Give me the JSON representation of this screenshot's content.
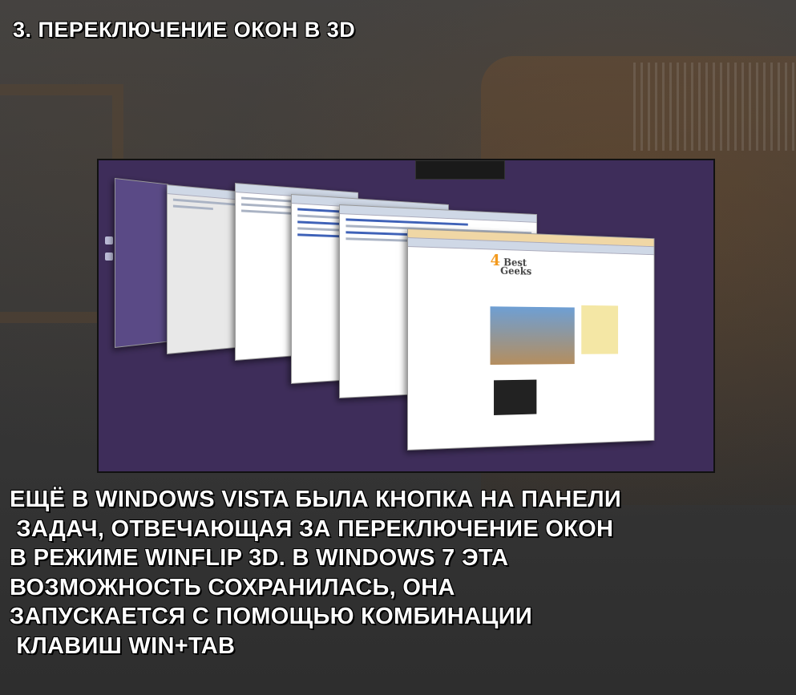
{
  "heading": "3. ПЕРЕКЛЮЧЕНИЕ ОКОН В 3D",
  "screenshot_logo": {
    "digit": "4",
    "word1": "Best",
    "word2": "Geeks"
  },
  "body_lines": [
    "ЕЩЁ В WINDOWS VISTA БЫЛА КНОПКА НА ПАНЕЛИ",
    " ЗАДАЧ, ОТВЕЧАЮЩАЯ ЗА ПЕРЕКЛЮЧЕНИЕ ОКОН",
    "В РЕЖИМЕ WINFLIP 3D. В WINDOWS 7 ЭТА",
    "ВОЗМОЖНОСТЬ СОХРАНИЛАСЬ, ОНА",
    "ЗАПУСКАЕТСЯ С ПОМОЩЬЮ КОМБИНАЦИИ",
    " КЛАВИШ WIN+TAB"
  ],
  "colors": {
    "desktop": "#3e2d5a",
    "logo_accent": "#f39a1e",
    "text": "#ffffff"
  }
}
